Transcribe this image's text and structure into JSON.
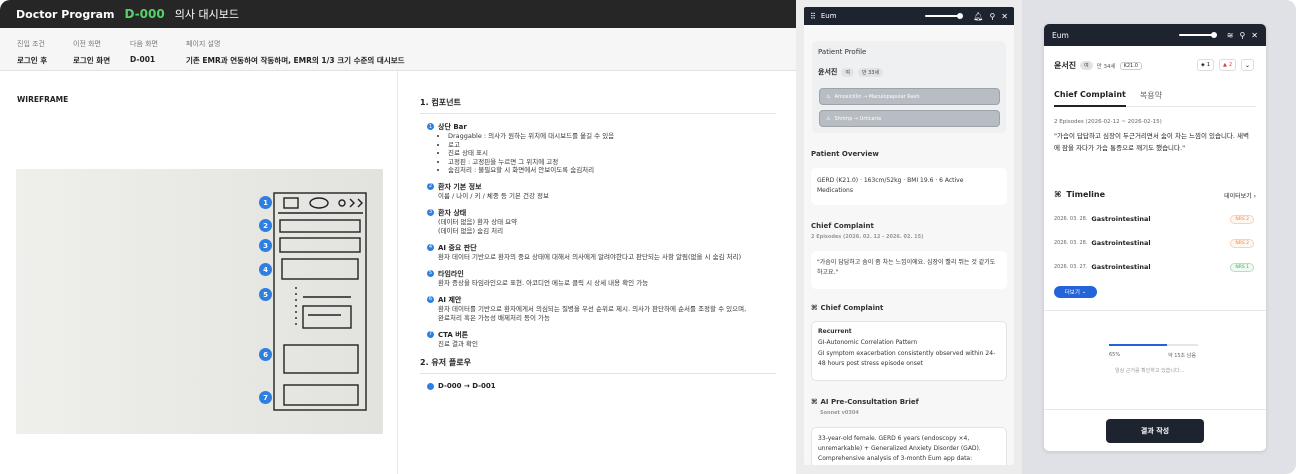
{
  "spec": {
    "header": {
      "program": "Doctor Program",
      "code": "D-000",
      "name": "의사 대시보드"
    },
    "meta": [
      {
        "label": "진입 조건",
        "value": "로그인 후"
      },
      {
        "label": "이전 화면",
        "value": "로그인 화면"
      },
      {
        "label": "다음 화면",
        "value": "D-001"
      },
      {
        "label": "페이지 설명",
        "value": "기존 EMR과 연동하여 작동하며, EMR의 1/3 크기 수준의 대시보드"
      }
    ],
    "wireframe_title": "WIREFRAME",
    "markers": [
      "1",
      "2",
      "3",
      "4",
      "5",
      "6",
      "7"
    ],
    "components_title": "1. 컴포넌트",
    "components": [
      {
        "n": "1",
        "title": "상단 Bar",
        "bullets": [
          "Draggable : 의사가 원하는 위치에 대시보드를 옮길 수 있음",
          "로고",
          "진료 상태 표시",
          "고정핀 : 고정핀을 누르면 그 위치에 고정",
          "숨김처리 : 불필요할 시 화면에서 안보이도록 숨김처리"
        ],
        "desc": []
      },
      {
        "n": "2",
        "title": "환자 기본 정보",
        "bullets": [],
        "desc": [
          "이름 / 나이 / 키 / 체중 등 기본 건강 정보"
        ]
      },
      {
        "n": "3",
        "title": "환자 상태",
        "bullets": [],
        "desc": [
          "(데이터 없음) 환자 상태 요약",
          "(데이터 없음) 숨김 처리"
        ]
      },
      {
        "n": "4",
        "title": "AI 중요 판단",
        "bullets": [],
        "desc": [
          "환자 데이터 기반으로 환자의 중요 상태에 대해서 의사에게 알려야한다고 판단되는 사항 알림(없을 시 숨김 처리)"
        ]
      },
      {
        "n": "5",
        "title": "타임라인",
        "bullets": [],
        "desc": [
          "환자 증상을 타임라인으로 표현. 아코디언 메뉴로 클릭 시 상세 내용 확인 가능"
        ]
      },
      {
        "n": "6",
        "title": "AI 제안",
        "bullets": [],
        "desc": [
          "환자 데이터를 기반으로 환자에게서 의심되는 질병을 우선 순위로 제시. 의사가 판단하에 순서를 조정할 수 있으며,",
          "완료처리 혹은 가능성 배제처리 등이 가능"
        ]
      },
      {
        "n": "7",
        "title": "CTA 버튼",
        "bullets": [],
        "desc": [
          "진료 결과 확인"
        ]
      }
    ],
    "flow_title": "2. 유저 플로우",
    "flow": "D-000 → D-001"
  },
  "phone1": {
    "app": "Eum",
    "profile_title": "Patient Profile",
    "patient_name": "윤서진",
    "sex": "여",
    "age": "만 33세",
    "allergies": [
      "Amoxicillin → Maculopapular Rash",
      "Shrimp → Urticaria"
    ],
    "overview_title": "Patient Overview",
    "overview": "GERD (K21.0) · 163cm/52kg · BMI 19.6 · 6 Active Medications",
    "cc_title": "Chief Complaint",
    "cc_sub": "2 Episodes (2026. 02. 12 - 2026. 02. 15)",
    "cc_quote": "\"가슴이 답답하고 숨이 좀 차는 느낌이에요. 심장이 빨리 뛰는 것 같기도 하고요.\"",
    "cc2_title": "Chief Complaint",
    "recurrent_label": "Recurrent",
    "recurrent_name": "GI-Autonomic Correlation Pattern",
    "recurrent_text": "GI symptom exacerbation consistently observed within 24-48 hours post stress episode onset",
    "brief_title": "AI Pre-Consultation Brief",
    "brief_model": "Sonnet v0304",
    "brief_text": "33-year-old female. GERD 6 years (endoscopy ×4, unremarkable) + Generalized Anxiety Disorder (GAD). Comprehensive analysis of 3-month Eum app data:"
  },
  "phone2": {
    "app": "Eum",
    "patient_name": "윤서진",
    "sex": "여",
    "age": "만 34세",
    "code": "K21.0",
    "badge1": "1",
    "badge2": "2",
    "tabs": [
      "Chief Complaint",
      "복용약"
    ],
    "episodes": "2 Episodes (2026-02-12 ~ 2026-02-15)",
    "quote": "\"가슴이 답답하고 심장이 두근거리면서 숨이 차는 느낌이 있습니다. 새벽에 잠을 자다가 가슴 통증으로 깨기도 했습니다.\"",
    "timeline_title": "Timeline",
    "timeline_more": "데이터보기",
    "timeline": [
      {
        "date": "2026. 03. 28.",
        "category": "Gastrointestinal",
        "nrs": "NRS 2",
        "color": "#f08a3c"
      },
      {
        "date": "2026. 03. 28.",
        "category": "Gastrointestinal",
        "nrs": "NRS 2",
        "color": "#f08a3c"
      },
      {
        "date": "2026. 03. 27.",
        "category": "Gastrointestinal",
        "nrs": "NRS 1",
        "color": "#3cae5a"
      }
    ],
    "more_button": "더보기",
    "progress_percent": "65%",
    "progress_value": 0.65,
    "progress_remaining": "약 15초 남음",
    "progress_status": "임상 근거를 확인하고 있습니다...",
    "cta": "결과 작성"
  }
}
